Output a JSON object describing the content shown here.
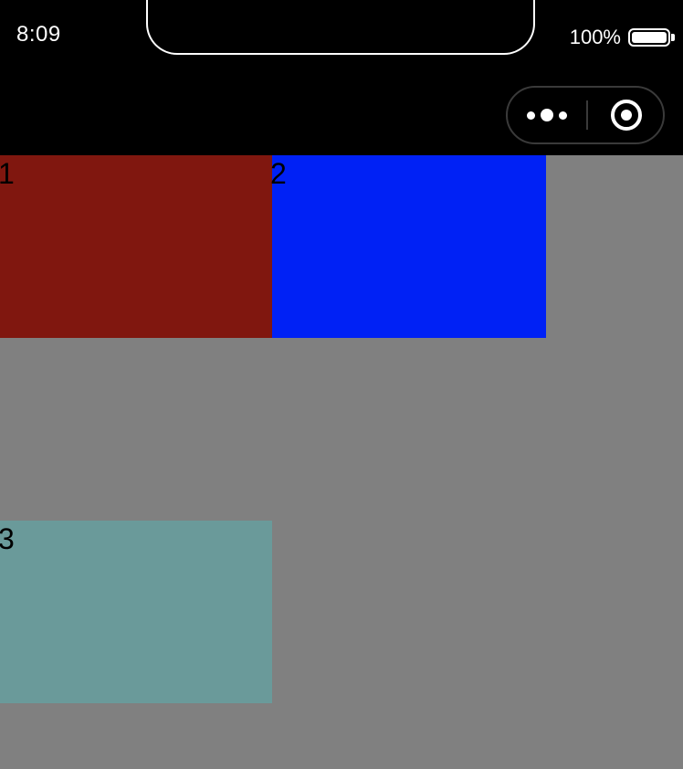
{
  "status_bar": {
    "time": "8:09",
    "battery_percent": "100%",
    "battery_level": 1.0
  },
  "capsule": {
    "more_icon": "more-dots-icon",
    "close_icon": "target-circle-icon"
  },
  "boxes": [
    {
      "label": "1",
      "color": "#80170f"
    },
    {
      "label": "2",
      "color": "#0021f5"
    },
    {
      "label": "3",
      "color": "#6a9a9a"
    }
  ],
  "colors": {
    "page_background": "#808080",
    "header_background": "#000000"
  }
}
